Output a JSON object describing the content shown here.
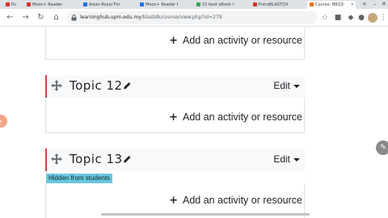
{
  "browser": {
    "tabs": [
      {
        "title": "Pu",
        "favicon": "#d93025"
      },
      {
        "title": "Moon+ Reader",
        "favicon": "#d93025"
      },
      {
        "title": "Asian Royal Fm",
        "favicon": "#1a73e8"
      },
      {
        "title": "Moon+ Reader Pr",
        "favicon": "#1a73e8"
      },
      {
        "title": "15 best eBook r",
        "favicon": "#34a853"
      },
      {
        "title": "PutraBLAST(Di",
        "favicon": "#d93025"
      },
      {
        "title": "Course: BBQ3:",
        "favicon": "#e37400",
        "active": true
      }
    ],
    "url_host": "learninghub.upm.edu.my",
    "url_path": "/blastdk/course/view.php?id=279"
  },
  "sections": [
    {
      "title": "Topic 12",
      "edit_label": "Edit",
      "add_label": "Add an activity or resource"
    },
    {
      "title": "Topic 13",
      "edit_label": "Edit",
      "badge": "Hidden from students",
      "add_label": "Add an activity or resource"
    }
  ],
  "top_add_label": "Add an activity or resource",
  "colors": {
    "accent": "#d33f49",
    "badge": "#6bc7dd"
  }
}
